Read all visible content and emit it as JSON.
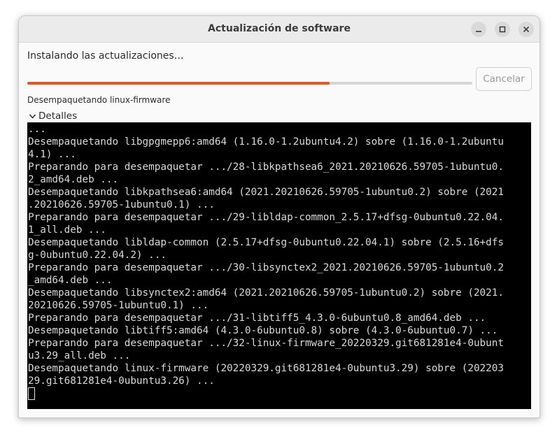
{
  "window": {
    "title": "Actualización de software"
  },
  "main": {
    "status_text": "Instalando las actualizaciones…",
    "progress_percent": 68,
    "cancel_label": "Cancelar",
    "current_action": "Desempaquetando linux-firmware",
    "details_label": "Detalles"
  },
  "colors": {
    "accent": "#e95420",
    "terminal_bg": "#000000"
  },
  "terminal": {
    "lines": [
      "...",
      "Desempaquetando libgpgmepp6:amd64 (1.16.0-1.2ubuntu4.2) sobre (1.16.0-1.2ubuntu",
      "4.1) ...",
      "Preparando para desempaquetar .../28-libkpathsea6_2021.20210626.59705-1ubuntu0.",
      "2_amd64.deb ...",
      "Desempaquetando libkpathsea6:amd64 (2021.20210626.59705-1ubuntu0.2) sobre (2021",
      ".20210626.59705-1ubuntu0.1) ...",
      "Preparando para desempaquetar .../29-libldap-common_2.5.17+dfsg-0ubuntu0.22.04.",
      "1_all.deb ...",
      "Desempaquetando libldap-common (2.5.17+dfsg-0ubuntu0.22.04.1) sobre (2.5.16+dfs",
      "g-0ubuntu0.22.04.2) ...",
      "Preparando para desempaquetar .../30-libsynctex2_2021.20210626.59705-1ubuntu0.2",
      "_amd64.deb ...",
      "Desempaquetando libsynctex2:amd64 (2021.20210626.59705-1ubuntu0.2) sobre (2021.",
      "20210626.59705-1ubuntu0.1) ...",
      "Preparando para desempaquetar .../31-libtiff5_4.3.0-6ubuntu0.8_amd64.deb ...",
      "Desempaquetando libtiff5:amd64 (4.3.0-6ubuntu0.8) sobre (4.3.0-6ubuntu0.7) ...",
      "Preparando para desempaquetar .../32-linux-firmware_20220329.git681281e4-0ubunt",
      "u3.29_all.deb ...",
      "Desempaquetando linux-firmware (20220329.git681281e4-0ubuntu3.29) sobre (202203",
      "29.git681281e4-0ubuntu3.26) ..."
    ]
  }
}
